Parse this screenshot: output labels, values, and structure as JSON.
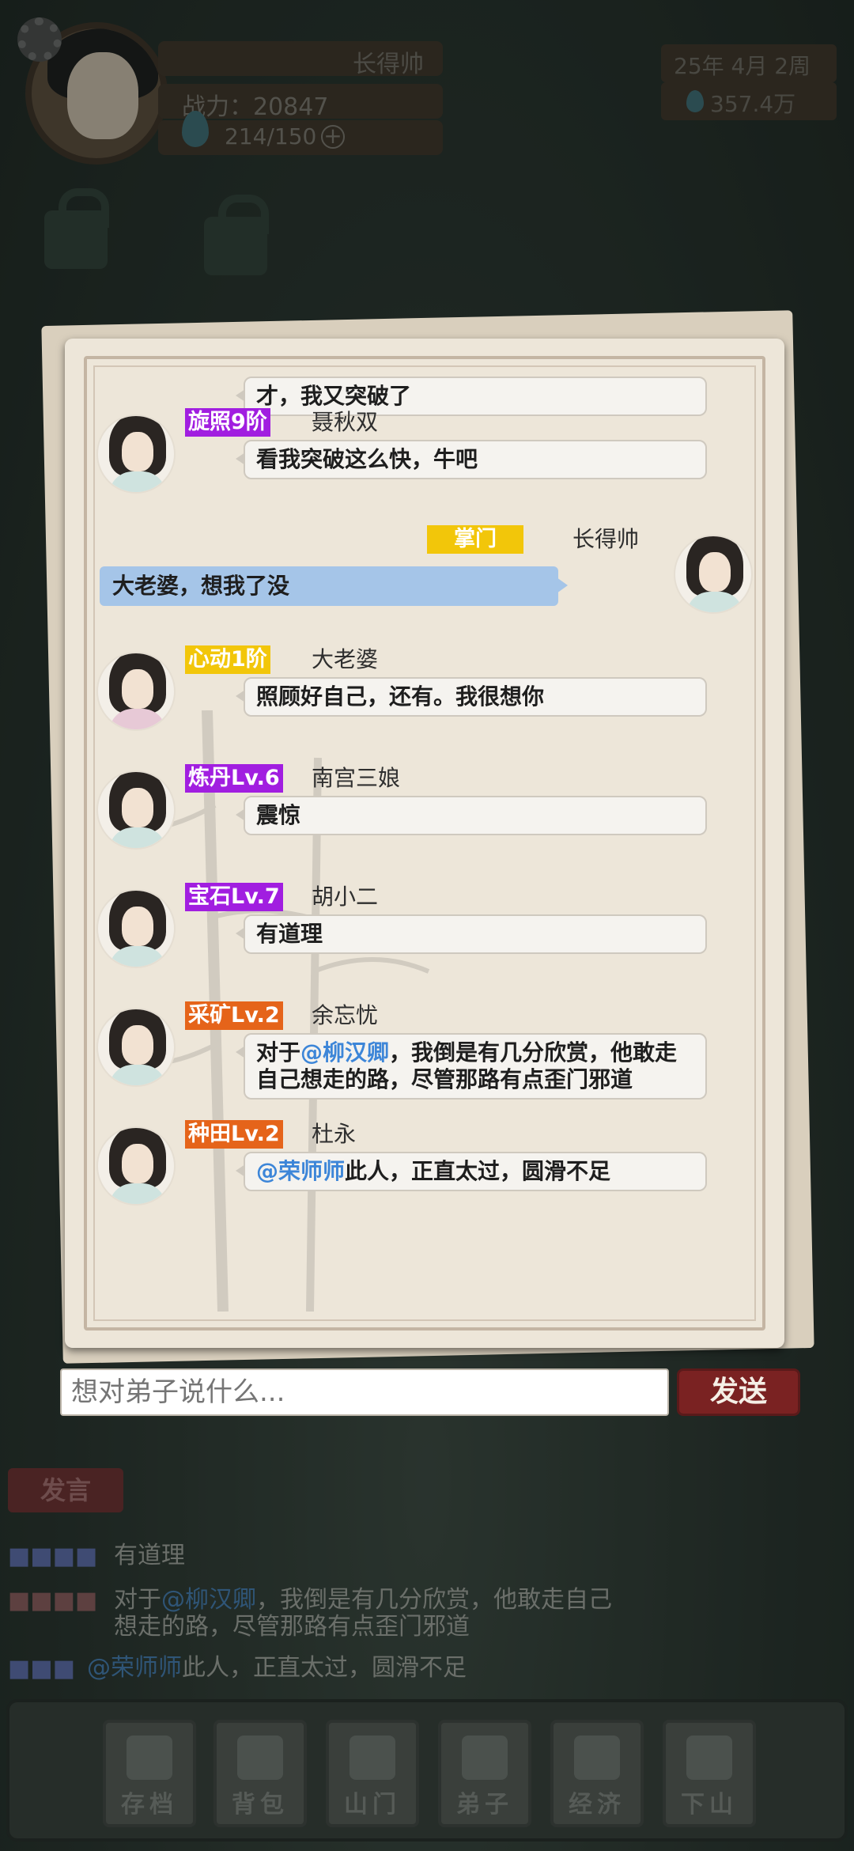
{
  "hud": {
    "player_name": "长得帅",
    "power": "战力：20847",
    "stamina": "214/150",
    "stamina_plus": "+",
    "date": "25年  4月  2周",
    "money": "357.4万"
  },
  "chat": {
    "partial_message": "才，我又突破了",
    "messages": [
      {
        "rank": "旋照9阶",
        "rank_color": "#a11ee0",
        "name": "聂秋双",
        "text": "看我突破这么快，牛吧"
      },
      {
        "rank": "掌门",
        "rank_color": "#f2c60a",
        "name": "长得帅",
        "text": "大老婆，想我了没"
      },
      {
        "rank": "心动1阶",
        "rank_color": "#f2c60a",
        "name": "大老婆",
        "text": "照顾好自己，还有。我很想你"
      },
      {
        "rank": "炼丹Lv.6",
        "rank_color": "#a11ee0",
        "name": "南宫三娘",
        "text": "震惊"
      },
      {
        "rank": "宝石Lv.7",
        "rank_color": "#a11ee0",
        "name": "胡小二",
        "text": "有道理"
      },
      {
        "rank": "采矿Lv.2",
        "rank_color": "#e5641a",
        "name": "余忘忧",
        "text_pre": "对于",
        "mention": "@柳汉卿",
        "text_post": "，我倒是有几分欣赏，他敢走自己想走的路，尽管那路有点歪门邪道"
      },
      {
        "rank": "种田Lv.2",
        "rank_color": "#e5641a",
        "name": "杜永",
        "mention": "@荣师师",
        "text_post": "此人，正直太过，圆滑不足"
      }
    ]
  },
  "input": {
    "placeholder": "想对弟子说什么...",
    "send_label": "发送"
  },
  "log": {
    "speak_label": "发言",
    "rows": [
      {
        "text": "有道理"
      },
      {
        "text_pre": "对于",
        "mention": "@柳汉卿",
        "text_post": "，我倒是有几分欣赏，他敢走自己想走的路，尽管那路有点歪门邪道"
      },
      {
        "mention": "@荣师师",
        "text_post": "此人，正直太过，圆滑不足"
      }
    ]
  },
  "nav": {
    "items": [
      "存档",
      "背包",
      "山门",
      "弟子",
      "经济",
      "下山"
    ]
  }
}
